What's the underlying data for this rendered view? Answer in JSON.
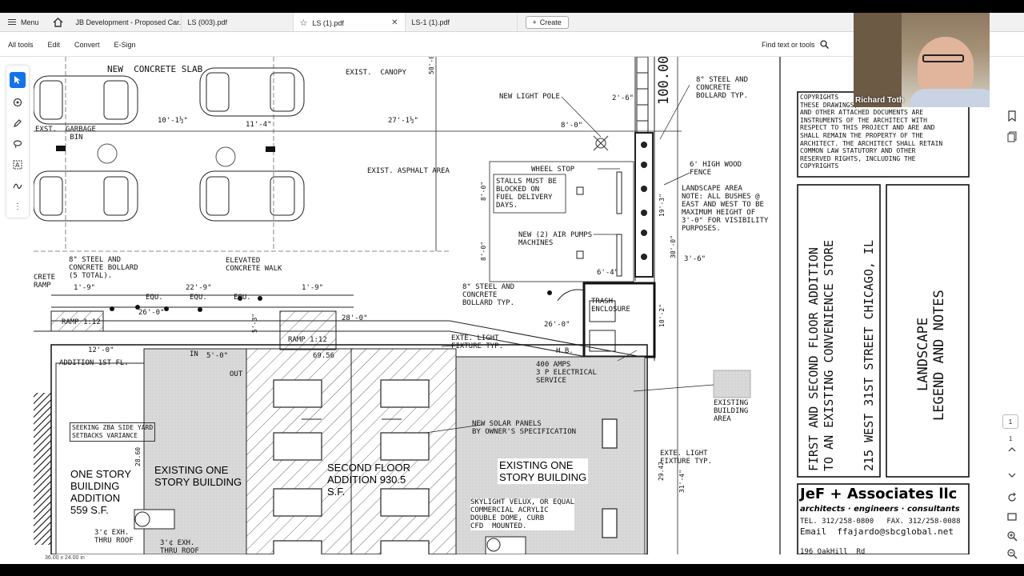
{
  "menu": {
    "label": "Menu"
  },
  "tabs": [
    {
      "label": "JB Development - Proposed Car..."
    },
    {
      "label": "LS (003).pdf"
    },
    {
      "label": "LS (1).pdf"
    },
    {
      "label": "LS-1 (1).pdf"
    }
  ],
  "create": {
    "label": "Create"
  },
  "toolbar": {
    "all_tools": "All tools",
    "edit": "Edit",
    "convert": "Convert",
    "esign": "E-Sign",
    "find": "Find text or tools"
  },
  "video": {
    "name": "Richard Toth"
  },
  "page_indicator": {
    "current": "1",
    "total": "1"
  },
  "status": {
    "size": "36.00 x 24.00 in"
  },
  "drawing": {
    "new_concrete_slab": "NEW  CONCRETE SLAB",
    "exist_canopy": "EXIST.  CANOPY",
    "new_light_pole": "NEW LIGHT POLE",
    "steel_bollard_1": "8\" STEEL AND\nCONCRETE\nBOLLARD TYP.",
    "garbage_bin": "EXST.  GARBAGE\n        BIN",
    "exist_asphalt": "EXIST. ASPHALT AREA",
    "wheel_stop": "WHEEL STOP",
    "stalls_note": "STALLS MUST BE\nBLOCKED ON\nFUEL DELIVERY\nDAYS.",
    "wood_fence": "6' HIGH WOOD\nFENCE",
    "landscape_note": "LANDSCAPE AREA\nNOTE: ALL BUSHES @\nEAST AND WEST TO BE\nMAXIMUM HEIGHT OF\n3'-0\" FOR VISIBILITY\nPURPOSES.",
    "air_pumps": "NEW (2) AIR PUMPS\nMACHINES",
    "steel_bollard_5": "8\" STEEL AND\nCONCRETE BOLLARD\n(5 TOTAL).",
    "elevated_walk": "ELEVATED\nCONCRETE WALK",
    "steel_bollard_2": "8\" STEEL AND\nCONCRETE\nBOLLARD TYP.",
    "trash": "TRASH\nENCLOSURE",
    "concrete_ramp": "CRETE\nRAMP",
    "ramp_1": "RAMP 1:12",
    "ramp_2": "RAMP 1:12",
    "exte_light_1": "EXTE. LIGHT\nFIXTURE TYP.",
    "hb": "H.B.",
    "amps": "400 AMPS\n3 P ELECTRICAL\nSERVICE",
    "existing_bldg_area": "EXISTING\nBUILDING\nAREA",
    "addition_1st": "ADDITION 1ST FL.",
    "solar": "NEW SOLAR PANELS\nBY OWNER'S SPECIFICATION",
    "zba": "SEEKING ZBA SIDE YARD\nSETBACKS VARIANCE",
    "one_story": "ONE STORY\nBUILDING\nADDITION\n559 S.F.",
    "existing_one_story_1": "EXISTING ONE\nSTORY BUILDING",
    "second_floor": "SECOND FLOOR\nADDITION 930.5\nS.F.",
    "existing_one_story_2": "EXISTING ONE\nSTORY BUILDING",
    "exte_light_2": "EXTE. LIGHT\nFIXTURE TYP.",
    "skylight": "SKYLIGHT VELUX, OR EQUAL\nCOMMERCIAL ACRYLIC\nDOUBLE DOME, CURB\nCFD  MOUNTED.",
    "exh_1": "3'¢ EXH.\nTHRU ROOF",
    "exh_2": "3'¢ EXH.\nTHRU ROOF",
    "in_label": "IN",
    "out_label": "OUT",
    "equ": "EQU.",
    "dim_100": "100.00",
    "dims": [
      "10'-1½\"",
      "11'-4\"",
      "27'-1½\"",
      "8'-0\"",
      "2'-6\"",
      "1'-9\"",
      "22'-9\"",
      "1'-9\"",
      "26'-0\"",
      "28'-0\"",
      "26'-0\"",
      "6'-4\"",
      "3'-6\"",
      "5'-0\"",
      "12'-0\"",
      "69.56",
      "29.42",
      "31'-4\"",
      "28.60",
      "10'-2\"",
      "30'-0\"",
      "19'-3\"",
      "5'-3\"",
      "50'-0\"",
      "8'-0\"",
      "8'-0\""
    ]
  },
  "title_block": {
    "copyrights": "COPYRIGHTS\nTHESE DRAWINGS, SPECIFICATIONS\nAND OTHER ATTACHED DOCUMENTS ARE\nINSTRUMENTS OF THE ARCHITECT WITH\nRESPECT TO THIS PROJECT AND ARE AND\nSHALL REMAIN THE PROPERTY OF THE\nARCHITECT. THE ARCHITECT SHALL RETAIN\nCOMMON LAW STATUTORY AND OTHER\nRESERVED RIGHTS, INCLUDING THE\nCOPYRIGHTS",
    "project_line1": "FIRST AND SECOND FLOOR ADDITION",
    "project_line2": "TO AN EXISTING CONVENIENCE STORE",
    "project_line3": "215 WEST 31ST STREET    CHICAGO,  IL",
    "sheet_line1": "LANDSCAPE",
    "sheet_line2": "LEGEND AND NOTES",
    "firm_name": "JeF + Associates llc",
    "firm_sub": "architects · engineers · consultants",
    "tel": "TEL. 312/258-0800   FAX. 312/258-0088",
    "email": "Email  ffajardo@sbcglobal.net",
    "address": "196 OakHill  Rd"
  }
}
